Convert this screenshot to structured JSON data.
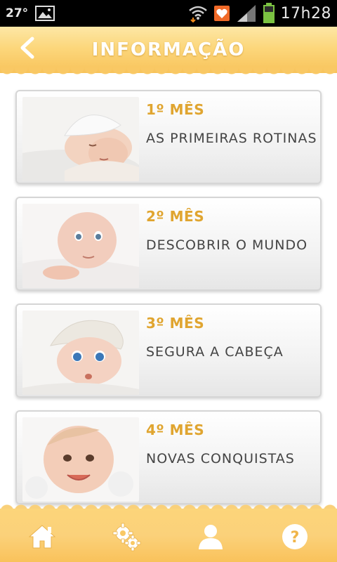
{
  "status_bar": {
    "temperature": "27°",
    "time": "17h28"
  },
  "header": {
    "title": "INFORMAÇÃO"
  },
  "items": [
    {
      "month": "1º MÊS",
      "subtitle": "AS PRIMEIRAS ROTINAS"
    },
    {
      "month": "2º MÊS",
      "subtitle": "DESCOBRIR O MUNDO"
    },
    {
      "month": "3º MÊS",
      "subtitle": "SEGURA A CABEÇA"
    },
    {
      "month": "4º MÊS",
      "subtitle": "NOVAS CONQUISTAS"
    }
  ],
  "bottom_nav": [
    "home-icon",
    "settings-icon",
    "profile-icon",
    "help-icon"
  ],
  "colors": {
    "accent": "#e0a530",
    "header_bg": "#fcd77c",
    "title_text": "#ffffff",
    "subtitle_text": "#444444"
  }
}
